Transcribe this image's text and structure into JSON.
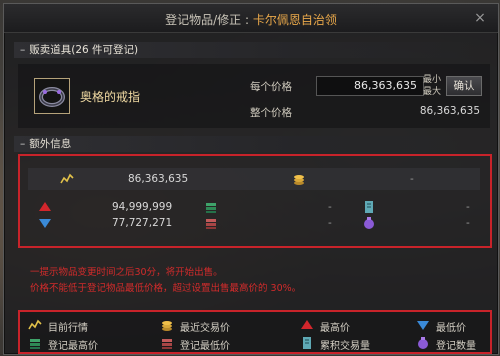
{
  "window": {
    "title_prefix": "登记物品/修正 : ",
    "title_highlight": "卡尔佩恩自治领",
    "close_glyph": "×"
  },
  "sale_section": {
    "header_dash": "–",
    "header": "贩卖道具(26 件可登记)",
    "item_name": "奥格的戒指",
    "unit_price_label": "每个价格",
    "unit_price_value": "86,363,635",
    "min_label": "最小",
    "max_label": "最大",
    "confirm_label": "确认",
    "total_price_label": "整个价格",
    "total_price_value": "86,363,635"
  },
  "extra_section": {
    "header_dash": "–",
    "header": "额外信息",
    "current_price": "86,363,635",
    "recent_trade_price": "-",
    "highest_price": "94,999,999",
    "lowest_price": "77,727,271",
    "reg_high_price": "-",
    "reg_low_price": "-",
    "cumulative_volume": "-",
    "reg_count": "-"
  },
  "warnings": [
    "一提示物品变更时间之后30分，将开始出售。",
    "价格不能低于登记物品最低价格，超过设置出售最高价的 30%。"
  ],
  "legend": {
    "items": [
      {
        "icon": "trend-line-icon",
        "label": "目前行情"
      },
      {
        "icon": "coin-stack-icon",
        "label": "最近交易价"
      },
      {
        "icon": "red-up-arrow-icon",
        "label": "最高价"
      },
      {
        "icon": "blue-down-arrow-icon",
        "label": "最低价"
      },
      {
        "icon": "green-stack-icon",
        "label": "登记最高价"
      },
      {
        "icon": "red-stack-icon",
        "label": "登记最低价"
      },
      {
        "icon": "scroll-icon",
        "label": "累积交易量"
      },
      {
        "icon": "purple-pouch-icon",
        "label": "登记数量"
      }
    ]
  },
  "colors": {
    "accent_title": "#e9a84a",
    "item_name": "#f0d9a2",
    "highlight_border": "#c8232a",
    "warning_text": "#d22b2b"
  }
}
